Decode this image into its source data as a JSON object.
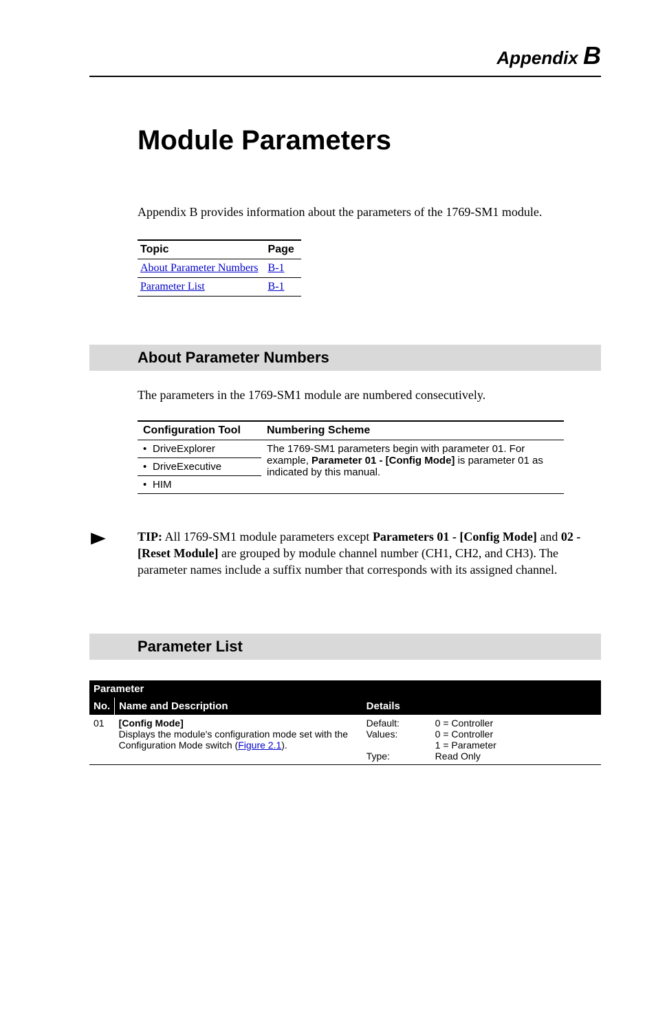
{
  "header": {
    "appendix_word": "Appendix",
    "appendix_letter": "B"
  },
  "title": "Module Parameters",
  "intro": "Appendix B provides information about the parameters of the 1769-SM1 module.",
  "topic_table": {
    "headers": [
      "Topic",
      "Page"
    ],
    "rows": [
      {
        "topic": "About Parameter Numbers",
        "page": "B-1"
      },
      {
        "topic": "Parameter List",
        "page": "B-1"
      }
    ]
  },
  "section1": {
    "heading": "About Parameter Numbers",
    "body": "The parameters in the 1769-SM1 module are numbered consecutively."
  },
  "config_table": {
    "headers": [
      "Configuration Tool",
      "Numbering Scheme"
    ],
    "tools": [
      "DriveExplorer",
      "DriveExecutive",
      "HIM"
    ],
    "scheme_line1": "The 1769-SM1 parameters begin with parameter 01. For example, ",
    "scheme_bold": "Parameter 01 - [Config Mode]",
    "scheme_line2": " is parameter 01 as indicated by this manual."
  },
  "tip": {
    "label": "TIP:",
    "text_pre": "  All 1769-SM1 module parameters except ",
    "bold1": "Parameters 01 - [Config Mode]",
    "text_mid": " and ",
    "bold2": "02 - [Reset Module]",
    "text_post": " are grouped by module channel number (CH1, CH2, and CH3). The parameter names include a suffix number that corresponds with its assigned channel."
  },
  "section2": {
    "heading": "Parameter List"
  },
  "param_table": {
    "group_header": "Parameter",
    "headers": {
      "no": "No.",
      "name": "Name and Description",
      "details": "Details"
    },
    "row": {
      "no": "01",
      "name_bold": "[Config Mode]",
      "name_desc": "Displays the module's configuration mode set with the Configuration Mode switch (",
      "name_link": "Figure 2.1",
      "name_desc_end": ").",
      "details": [
        {
          "label": "Default:",
          "value": "0 = Controller"
        },
        {
          "label": "Values:",
          "value": "0 = Controller"
        },
        {
          "label": "",
          "value": "1 = Parameter"
        },
        {
          "label": "Type:",
          "value": "Read Only"
        }
      ]
    }
  }
}
